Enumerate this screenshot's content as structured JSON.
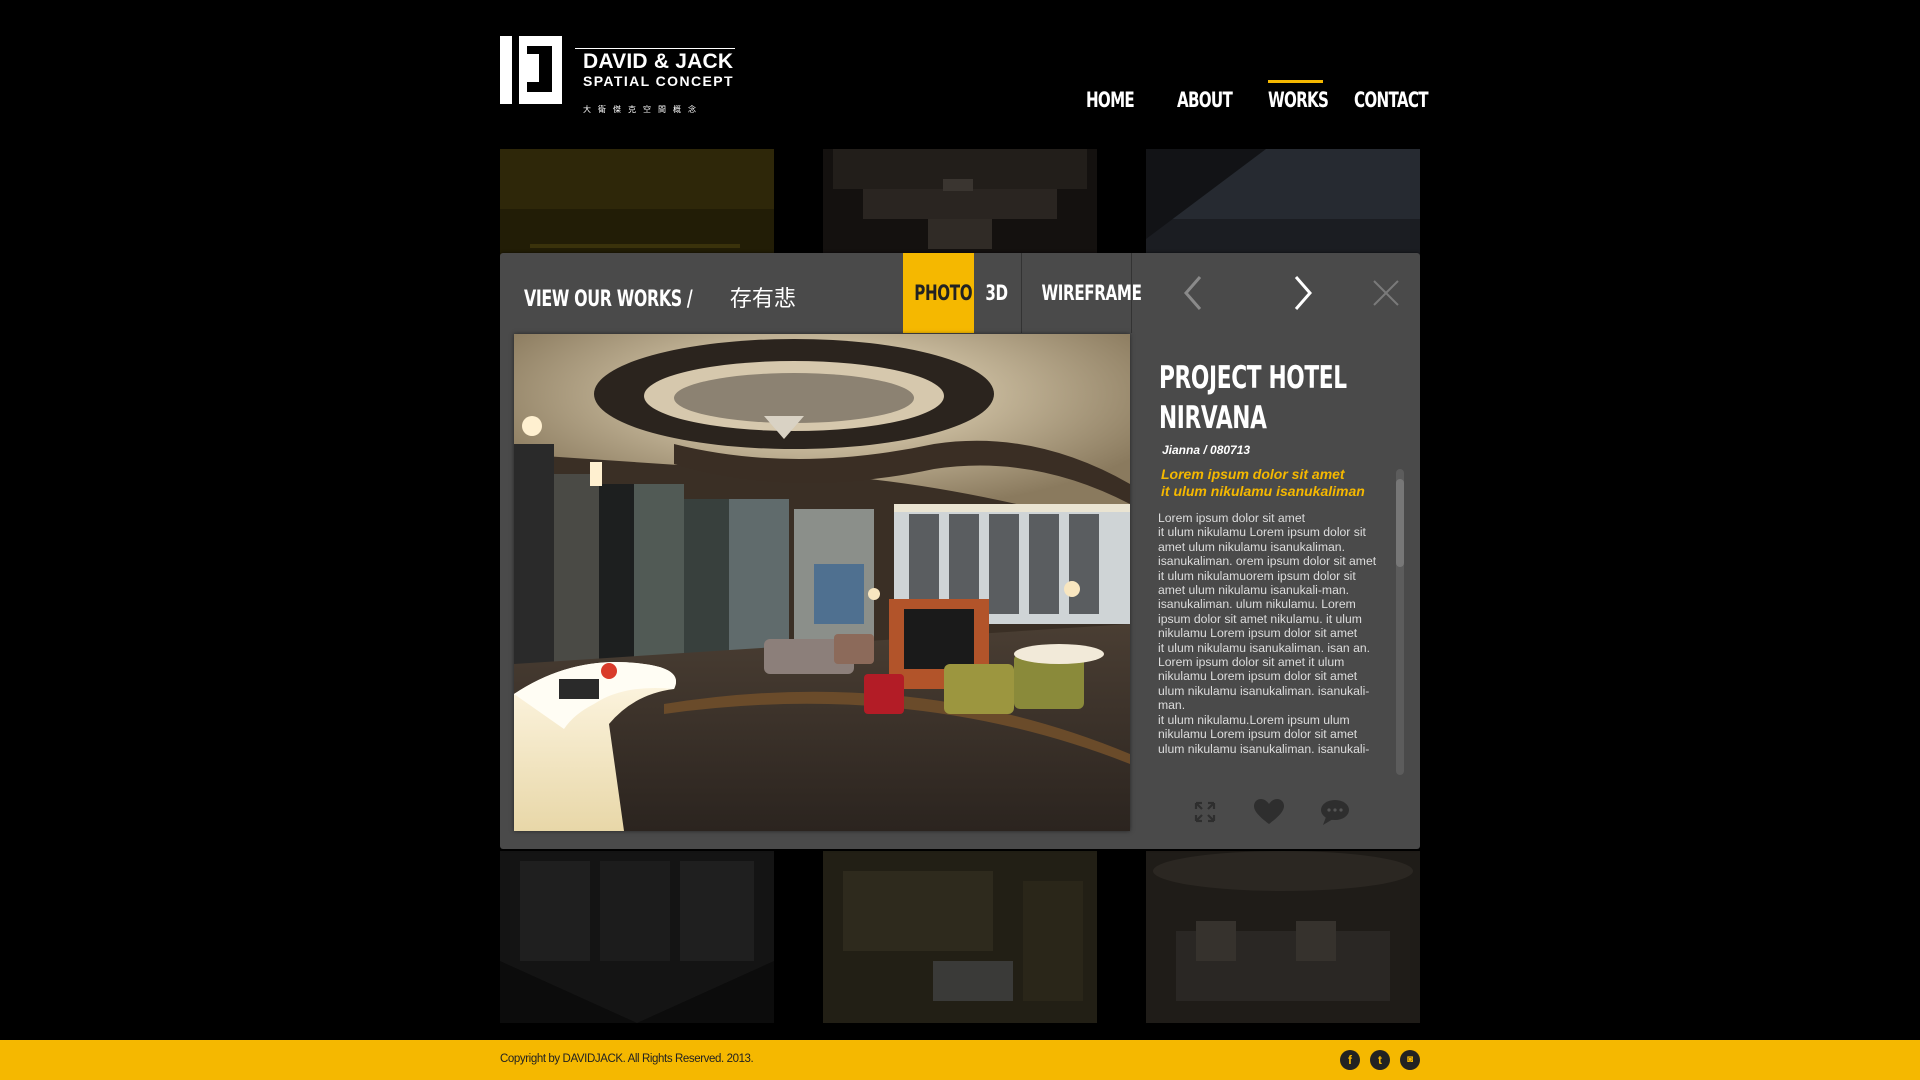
{
  "brand": {
    "name": "DAVID & JACK",
    "tagline": "SPATIAL CONCEPT",
    "chinese": "大衛傑克空間概念"
  },
  "nav": {
    "items": [
      {
        "label": "HOME"
      },
      {
        "label": "ABOUT"
      },
      {
        "label": "WORKS",
        "active": true
      },
      {
        "label": "CONTACT"
      }
    ]
  },
  "modal": {
    "title_en": "VIEW  OUR WORKS /",
    "title_zh": "存有悲",
    "tabs": [
      {
        "label": "PHOTO",
        "active": true
      },
      {
        "label": "3D"
      },
      {
        "label": "WIREFRAME"
      }
    ],
    "controls": {
      "prev": "chevron-left-icon",
      "next": "chevron-right-icon",
      "close": "close-icon"
    },
    "project": {
      "title_line1": "PROJECT HOTEL",
      "title_line2": "NIRVANA",
      "meta": "Jianna / 080713",
      "subtitle_line1": "Lorem ipsum dolor sit amet",
      "subtitle_line2": "it ulum nikulamu isanukaliman",
      "body": "Lorem ipsum dolor sit amet\nit ulum nikulamu Lorem ipsum dolor sit amet ulum nikulamu isanukaliman. isanukaliman. orem ipsum dolor sit amet it ulum nikulamuorem ipsum dolor sit amet ulum nikulamu isanukali-man. isanukaliman. ulum nikulamu. Lorem ipsum dolor sit amet nikulamu. it ulum nikulamu Lorem ipsum dolor sit amet\nit ulum nikulamu isanukaliman. isan an. Lorem ipsum dolor sit amet it ulum nikulamu Lorem ipsum dolor sit amet ulum nikulamu isanukaliman. isanukali-man.\nit ulum nikulamu.Lorem ipsum  ulum nikulamu Lorem ipsum dolor sit amet ulum nikulamu isanukaliman. isanukali-"
    },
    "actions": [
      "expand-icon",
      "heart-icon",
      "comment-icon"
    ]
  },
  "footer": {
    "copyright": "Copyright by DAVIDJACK. All Rights Reserved. 2013.",
    "social": [
      {
        "name": "facebook-icon",
        "glyph": "f"
      },
      {
        "name": "twitter-icon",
        "glyph": "t"
      },
      {
        "name": "instagram-icon",
        "glyph": "◙"
      }
    ]
  },
  "colors": {
    "accent": "#f5b800",
    "modal_bg": "#4a4a4a",
    "page_bg": "#000000"
  }
}
